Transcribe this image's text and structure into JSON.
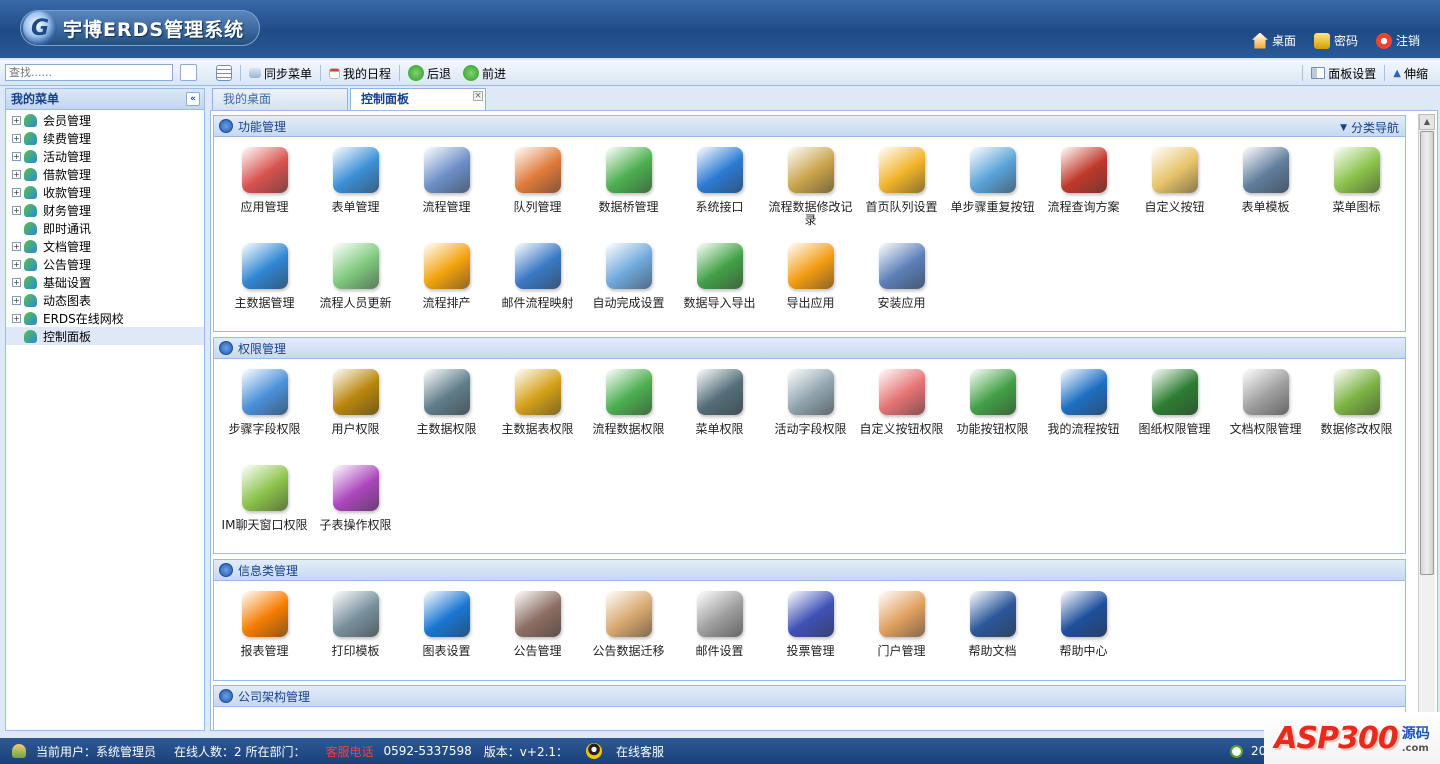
{
  "app": {
    "title": "宇博ERDS管理系统",
    "logo_letter": "G"
  },
  "top_links": [
    {
      "label": "桌面",
      "icon": "home-icon",
      "color": "#f5a623"
    },
    {
      "label": "密码",
      "icon": "lock-icon",
      "color": "#f2c94c"
    },
    {
      "label": "注销",
      "icon": "logout-icon",
      "color": "#e8462f"
    }
  ],
  "search": {
    "placeholder": "查找......"
  },
  "toolbar": {
    "sync_menu": "同步菜单",
    "my_schedule": "我的日程",
    "back": "后退",
    "forward": "前进",
    "panel_settings": "面板设置",
    "collapse": "伸缩"
  },
  "sidebar": {
    "title": "我的菜单",
    "items": [
      {
        "label": "会员管理",
        "expandable": true
      },
      {
        "label": "续费管理",
        "expandable": true
      },
      {
        "label": "活动管理",
        "expandable": true
      },
      {
        "label": "借款管理",
        "expandable": true
      },
      {
        "label": "收款管理",
        "expandable": true
      },
      {
        "label": "财务管理",
        "expandable": true
      },
      {
        "label": "即时通讯",
        "expandable": false
      },
      {
        "label": "文档管理",
        "expandable": true
      },
      {
        "label": "公告管理",
        "expandable": true
      },
      {
        "label": "基础设置",
        "expandable": true
      },
      {
        "label": "动态图表",
        "expandable": true
      },
      {
        "label": "ERDS在线网校",
        "expandable": true
      },
      {
        "label": "控制面板",
        "expandable": false,
        "active": true
      }
    ]
  },
  "tabs": [
    {
      "label": "我的桌面",
      "active": false
    },
    {
      "label": "控制面板",
      "active": true
    }
  ],
  "panels": [
    {
      "title": "功能管理",
      "nav_label": "分类导航",
      "items": [
        {
          "label": "应用管理",
          "color": "#d9534f"
        },
        {
          "label": "表单管理",
          "color": "#3c8fd6"
        },
        {
          "label": "流程管理",
          "color": "#6d8fc7"
        },
        {
          "label": "队列管理",
          "color": "#e07b3a"
        },
        {
          "label": "数据桥管理",
          "color": "#4caf50"
        },
        {
          "label": "系统接口",
          "color": "#2b7bd3"
        },
        {
          "label": "流程数据修改记录",
          "color": "#c9a44a"
        },
        {
          "label": "首页队列设置",
          "color": "#f0b429"
        },
        {
          "label": "单步骤重复按钮",
          "color": "#5aa3d8"
        },
        {
          "label": "流程查询方案",
          "color": "#c0392b"
        },
        {
          "label": "自定义按钮",
          "color": "#e6c36a"
        },
        {
          "label": "表单模板",
          "color": "#607d9c"
        },
        {
          "label": "菜单图标",
          "color": "#8bc34a"
        },
        {
          "label": "主数据管理",
          "color": "#2f86d3"
        },
        {
          "label": "流程人员更新",
          "color": "#7fc97f"
        },
        {
          "label": "流程排产",
          "color": "#f2a20c"
        },
        {
          "label": "邮件流程映射",
          "color": "#3a79c4"
        },
        {
          "label": "自动完成设置",
          "color": "#6fa8dc"
        },
        {
          "label": "数据导入导出",
          "color": "#43a047"
        },
        {
          "label": "导出应用",
          "color": "#f39c12"
        },
        {
          "label": "安装应用",
          "color": "#5c7fb8"
        }
      ]
    },
    {
      "title": "权限管理",
      "items": [
        {
          "label": "步骤字段权限",
          "color": "#4a90d9"
        },
        {
          "label": "用户权限",
          "color": "#b8860b"
        },
        {
          "label": "主数据权限",
          "color": "#607d8b"
        },
        {
          "label": "主数据表权限",
          "color": "#d4a017"
        },
        {
          "label": "流程数据权限",
          "color": "#4caf50"
        },
        {
          "label": "菜单权限",
          "color": "#546e7a"
        },
        {
          "label": "活动字段权限",
          "color": "#90a4ae"
        },
        {
          "label": "自定义按钮权限",
          "color": "#e57373"
        },
        {
          "label": "功能按钮权限",
          "color": "#43a047"
        },
        {
          "label": "我的流程按钮",
          "color": "#1e6fc2"
        },
        {
          "label": "图纸权限管理",
          "color": "#2e7d32"
        },
        {
          "label": "文档权限管理",
          "color": "#9e9e9e"
        },
        {
          "label": "数据修改权限",
          "color": "#7cb342"
        },
        {
          "label": "IM聊天窗口权限",
          "color": "#8bc34a"
        },
        {
          "label": "子表操作权限",
          "color": "#ab47bc"
        }
      ]
    },
    {
      "title": "信息类管理",
      "items": [
        {
          "label": "报表管理",
          "color": "#f57c00"
        },
        {
          "label": "打印模板",
          "color": "#78909c"
        },
        {
          "label": "图表设置",
          "color": "#1976d2"
        },
        {
          "label": "公告管理",
          "color": "#8d6e63"
        },
        {
          "label": "公告数据迁移",
          "color": "#d7a86e"
        },
        {
          "label": "邮件设置",
          "color": "#9e9e9e"
        },
        {
          "label": "投票管理",
          "color": "#3f51b5"
        },
        {
          "label": "门户管理",
          "color": "#e0a060"
        },
        {
          "label": "帮助文档",
          "color": "#2b579a"
        },
        {
          "label": "帮助中心",
          "color": "#1e4f9c"
        }
      ]
    },
    {
      "title": "公司架构管理",
      "items": []
    }
  ],
  "status": {
    "current_user_label": "当前用户：系统管理员",
    "online_label": "在线人数：2 所在部门：",
    "service_phone_label": "客服电话",
    "service_phone": "0592-5337598",
    "version": "版本：v+2.1：",
    "online_service": "在线客服",
    "clock_text": "20"
  },
  "watermark": {
    "brand": "ASP300",
    "side_top": "源码",
    "side_bottom": ".com"
  }
}
